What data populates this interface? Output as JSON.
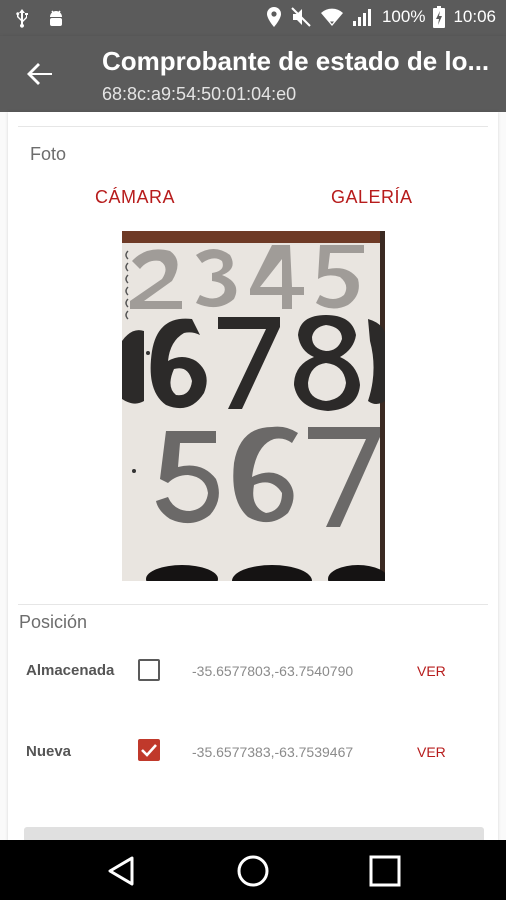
{
  "status_bar": {
    "left_icons": [
      "usb-icon",
      "android-debug-icon"
    ],
    "right_icons": [
      "location-icon",
      "mute-icon",
      "wifi-icon",
      "signal-icon"
    ],
    "battery": "100%",
    "time": "10:06"
  },
  "app_bar": {
    "title": "Comprobante de estado de lo...",
    "subtitle": "68:8c:a9:54:50:01:04:e0"
  },
  "photo_section": {
    "label": "Foto",
    "camera_label": "CÁMARA",
    "gallery_label": "GALERÍA"
  },
  "position_section": {
    "label": "Posición",
    "rows": [
      {
        "label": "Almacenada",
        "checked": false,
        "coords": "-35.6577803,-63.7540790",
        "action": "VER"
      },
      {
        "label": "Nueva",
        "checked": true,
        "coords": "-35.6577383,-63.7539467",
        "action": "VER"
      }
    ]
  },
  "colors": {
    "accent": "#b71c1c",
    "checkbox_on": "#c0392b",
    "app_bar": "#5b5b5b"
  }
}
